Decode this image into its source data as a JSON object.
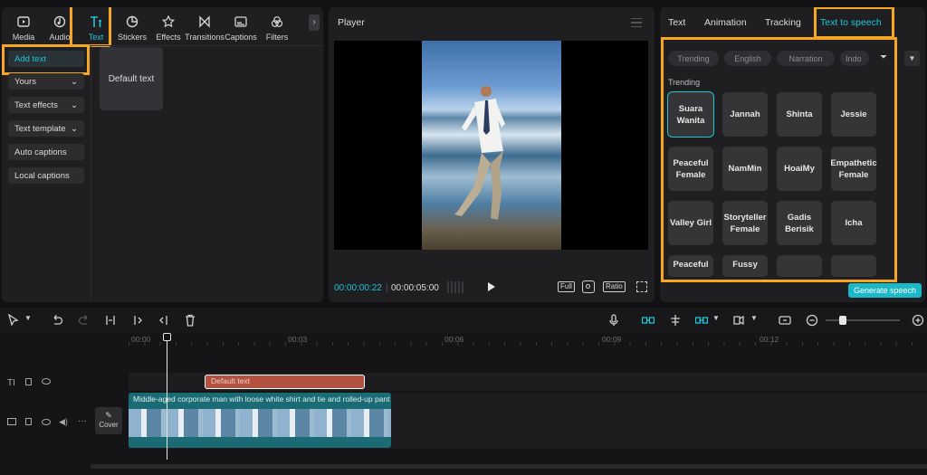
{
  "left_panel": {
    "tabs": [
      {
        "label": "Media",
        "icon": "media-icon"
      },
      {
        "label": "Audio",
        "icon": "audio-icon"
      },
      {
        "label": "Text",
        "icon": "text-icon"
      },
      {
        "label": "Stickers",
        "icon": "stickers-icon"
      },
      {
        "label": "Effects",
        "icon": "effects-icon"
      },
      {
        "label": "Transitions",
        "icon": "transitions-icon"
      },
      {
        "label": "Captions",
        "icon": "captions-icon"
      },
      {
        "label": "Filters",
        "icon": "filters-icon"
      }
    ],
    "active_tab": "Text",
    "side": [
      {
        "label": "Add text",
        "chevron": ""
      },
      {
        "label": "Yours",
        "chevron": "⌄"
      },
      {
        "label": "Text effects",
        "chevron": "⌄"
      },
      {
        "label": "Text template",
        "chevron": "⌄"
      },
      {
        "label": "Auto captions",
        "chevron": ""
      },
      {
        "label": "Local captions",
        "chevron": ""
      }
    ],
    "default_card": "Default text"
  },
  "player": {
    "title": "Player",
    "current_time": "00:00:00:22",
    "total_time": "00:00:05:00",
    "full_label": "Full",
    "ratio_label": "Ratio"
  },
  "right_panel": {
    "tabs": [
      "Text",
      "Animation",
      "Tracking",
      "Text to speech"
    ],
    "active_tab": "Text to speech",
    "filters": [
      "Trending",
      "English",
      "Narration",
      "Indo"
    ],
    "section": "Trending",
    "voices": [
      "Suara Wanita",
      "Jannah",
      "Shinta",
      "Jessie",
      "Peaceful Female",
      "NamMin",
      "HoaiMy",
      "Empathetic Female",
      "Valley Girl",
      "Storyteller Female",
      "Gadis Berisik",
      "Icha",
      "Peaceful",
      "Fussy",
      "",
      ""
    ],
    "selected_voice": "Suara Wanita",
    "generate_label": "Generate speech"
  },
  "timeline": {
    "ruler": [
      "00:00",
      "00:03",
      "00:06",
      "00:09",
      "00:12"
    ],
    "text_clip": "Default text",
    "video_clip": "Middle-aged corporate man with loose white shirt and tie and rolled-up pant",
    "cover_label": "Cover",
    "playhead_seconds": 0.73
  },
  "colors": {
    "accent": "#20c5d8",
    "highlight": "#f5a623",
    "text_clip": "#b4523f",
    "video_clip": "#1b6b74"
  }
}
